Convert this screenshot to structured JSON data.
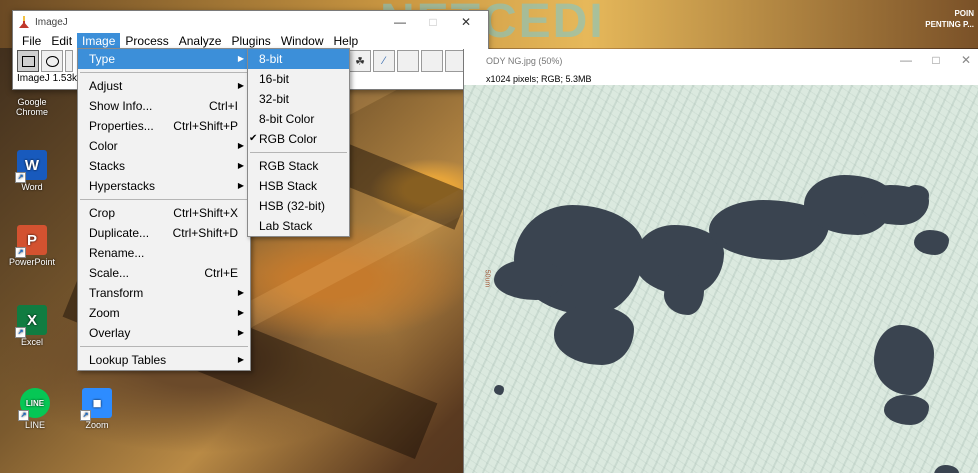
{
  "desktop": {
    "banner_text": "NETCEDI",
    "corner_text_1": "POIN",
    "corner_text_2": "PENTING P...",
    "icons": [
      {
        "label": "Google Chrome",
        "color": "#4a8af4",
        "glyph": ""
      },
      {
        "label": "Word",
        "color": "#185abd",
        "glyph": "W"
      },
      {
        "label": "PowerPoint",
        "color": "#d35230",
        "glyph": "P"
      },
      {
        "label": "Excel",
        "color": "#107c41",
        "glyph": "X"
      },
      {
        "label": "LINE",
        "color": "#06c755",
        "glyph": "LINE"
      },
      {
        "label": "Zoom",
        "color": "#2d8cff",
        "glyph": "■"
      }
    ]
  },
  "imagej": {
    "title": "ImageJ",
    "menubar": [
      "File",
      "Edit",
      "Image",
      "Process",
      "Analyze",
      "Plugins",
      "Window",
      "Help"
    ],
    "active_menu": "Image",
    "status": "ImageJ 1.53k"
  },
  "image_window": {
    "title": "ODY NG.jpg (50%)",
    "info": "x1024 pixels; RGB; 5.3MB",
    "scale_label": "50um"
  },
  "image_menu": [
    {
      "label": "Type",
      "shortcut": "",
      "submenu": true,
      "highlight": true
    },
    {
      "sep": true
    },
    {
      "label": "Adjust",
      "shortcut": "",
      "submenu": true
    },
    {
      "label": "Show Info...",
      "shortcut": "Ctrl+I",
      "submenu": false
    },
    {
      "label": "Properties...",
      "shortcut": "Ctrl+Shift+P",
      "submenu": false
    },
    {
      "label": "Color",
      "shortcut": "",
      "submenu": true
    },
    {
      "label": "Stacks",
      "shortcut": "",
      "submenu": true
    },
    {
      "label": "Hyperstacks",
      "shortcut": "",
      "submenu": true
    },
    {
      "sep": true
    },
    {
      "label": "Crop",
      "shortcut": "Ctrl+Shift+X",
      "submenu": false
    },
    {
      "label": "Duplicate...",
      "shortcut": "Ctrl+Shift+D",
      "submenu": false
    },
    {
      "label": "Rename...",
      "shortcut": "",
      "submenu": false
    },
    {
      "label": "Scale...",
      "shortcut": "Ctrl+E",
      "submenu": false
    },
    {
      "label": "Transform",
      "shortcut": "",
      "submenu": true
    },
    {
      "label": "Zoom",
      "shortcut": "",
      "submenu": true
    },
    {
      "label": "Overlay",
      "shortcut": "",
      "submenu": true
    },
    {
      "sep": true
    },
    {
      "label": "Lookup Tables",
      "shortcut": "",
      "submenu": true
    }
  ],
  "type_menu": [
    {
      "label": "8-bit",
      "highlight": true,
      "checked": false
    },
    {
      "label": "16-bit",
      "highlight": false,
      "checked": false
    },
    {
      "label": "32-bit",
      "highlight": false,
      "checked": false
    },
    {
      "label": "8-bit Color",
      "highlight": false,
      "checked": false
    },
    {
      "label": "RGB Color",
      "highlight": false,
      "checked": true
    },
    {
      "sep": true
    },
    {
      "label": "RGB Stack",
      "highlight": false,
      "checked": false
    },
    {
      "label": "HSB Stack",
      "highlight": false,
      "checked": false
    },
    {
      "label": "HSB (32-bit)",
      "highlight": false,
      "checked": false
    },
    {
      "label": "Lab Stack",
      "highlight": false,
      "checked": false
    }
  ]
}
